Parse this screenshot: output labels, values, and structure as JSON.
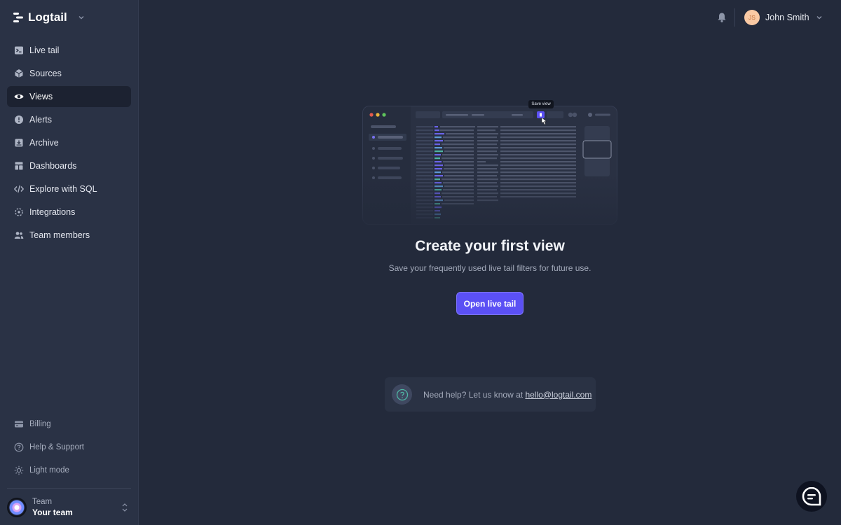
{
  "app": {
    "name": "Logtail"
  },
  "sidebar": {
    "items": [
      {
        "label": "Live tail",
        "icon": "terminal-icon"
      },
      {
        "label": "Sources",
        "icon": "cube-icon"
      },
      {
        "label": "Views",
        "icon": "eye-icon",
        "active": true
      },
      {
        "label": "Alerts",
        "icon": "alert-icon"
      },
      {
        "label": "Archive",
        "icon": "archive-icon"
      },
      {
        "label": "Dashboards",
        "icon": "dashboard-icon"
      },
      {
        "label": "Explore with SQL",
        "icon": "code-icon"
      },
      {
        "label": "Integrations",
        "icon": "integrations-icon"
      },
      {
        "label": "Team members",
        "icon": "users-icon"
      }
    ],
    "bottom_items": [
      {
        "label": "Billing",
        "icon": "credit-card-icon"
      },
      {
        "label": "Help & Support",
        "icon": "help-circle-icon"
      },
      {
        "label": "Light mode",
        "icon": "sun-icon"
      }
    ],
    "team": {
      "label": "Team",
      "name": "Your team"
    }
  },
  "header": {
    "user": {
      "initials": "JS",
      "name": "John Smith"
    }
  },
  "empty_state": {
    "tooltip": "Save view",
    "title": "Create your first view",
    "subtitle": "Save your frequently used live tail filters for future use.",
    "button": "Open live tail"
  },
  "help": {
    "text": "Need help? Let us know at ",
    "email": "hello@logtail.com"
  },
  "colors": {
    "background": "#232a3b",
    "sidebar": "#2a3245",
    "accent": "#5b50f4"
  }
}
